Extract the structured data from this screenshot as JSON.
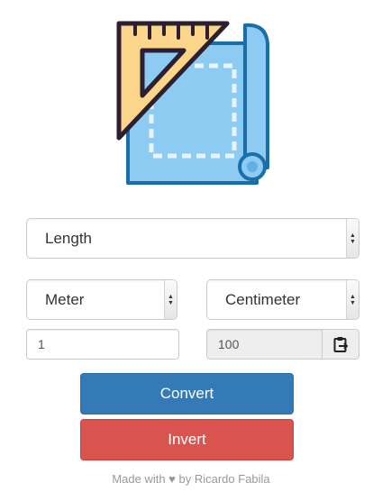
{
  "category": {
    "selected": "Length"
  },
  "from_unit": {
    "selected": "Meter"
  },
  "to_unit": {
    "selected": "Centimeter"
  },
  "input_value": "1",
  "result_value": "100",
  "buttons": {
    "convert": "Convert",
    "invert": "Invert"
  },
  "footer": "Made with ♥ by Ricardo Fabila",
  "icons": {
    "logo": "ruler-blueprint-icon",
    "copy": "clipboard-icon",
    "dropdown": "chevron-updown-icon"
  },
  "colors": {
    "convert": "#337ab7",
    "invert": "#d9534f",
    "blueprint": "#8ecbf2",
    "ruler": "#fbd68a"
  }
}
